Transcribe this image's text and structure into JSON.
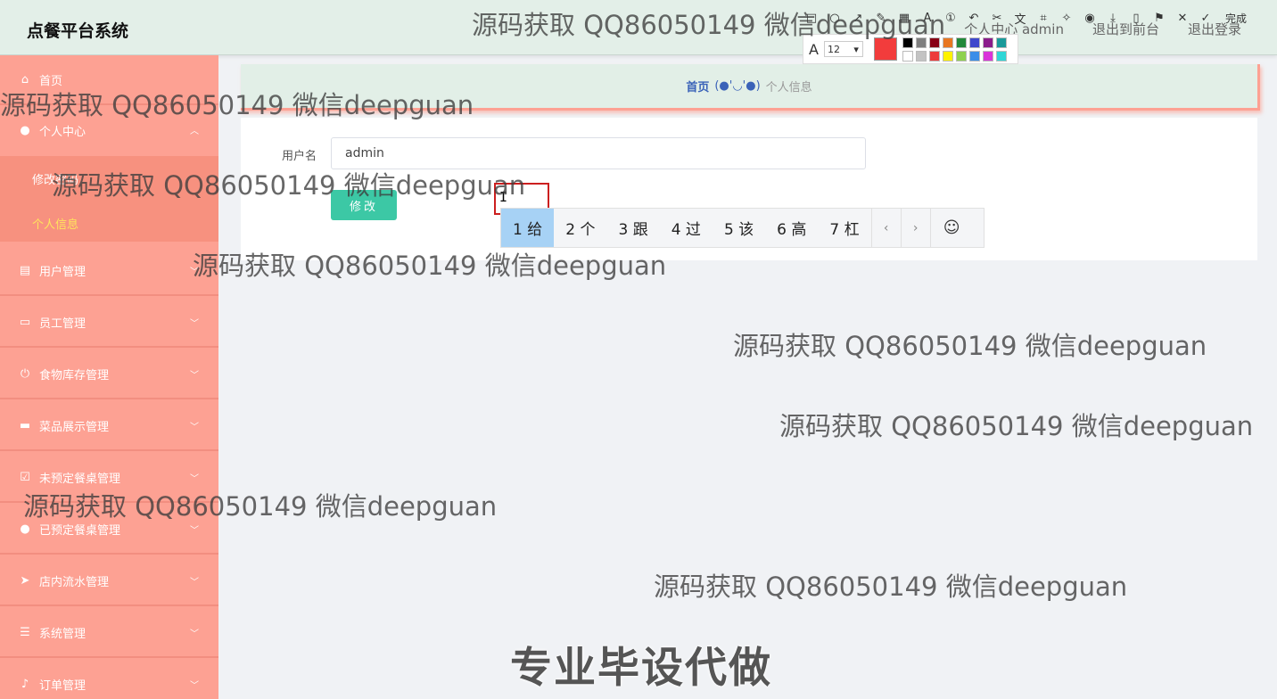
{
  "app": {
    "title": "点餐平台系统"
  },
  "header": {
    "links": [
      "个人中心 admin",
      "退出到前台",
      "退出登录"
    ]
  },
  "sidebar": {
    "items": [
      {
        "label": "首页",
        "icon": "home-icon"
      },
      {
        "label": "个人中心",
        "icon": "user-icon",
        "expanded": true
      },
      {
        "label": "用户管理",
        "icon": "clipboard-icon"
      },
      {
        "label": "员工管理",
        "icon": "id-card-icon"
      },
      {
        "label": "食物库存管理",
        "icon": "power-icon"
      },
      {
        "label": "菜品展示管理",
        "icon": "monitor-icon"
      },
      {
        "label": "未预定餐桌管理",
        "icon": "checklist-icon"
      },
      {
        "label": "已预定餐桌管理",
        "icon": "bulb-icon"
      },
      {
        "label": "店内流水管理",
        "icon": "send-icon"
      },
      {
        "label": "系统管理",
        "icon": "sliders-icon"
      },
      {
        "label": "订单管理",
        "icon": "bell-off-icon"
      }
    ],
    "submenu": [
      {
        "label": "修改密码"
      },
      {
        "label": "个人信息",
        "active": true
      }
    ]
  },
  "breadcrumb": {
    "home": "首页",
    "separator": "(●'◡'●)",
    "current": "个人信息"
  },
  "form": {
    "username_label": "用户名",
    "username_value": "admin",
    "submit_label": "修改"
  },
  "ime": {
    "candidates": [
      "1 给",
      "2 个",
      "3 跟",
      "4 过",
      "5 该",
      "6 高",
      "7 杠"
    ],
    "prev": "‹",
    "next": "›",
    "emoji": "☺"
  },
  "screenshot_tool": {
    "done_label": "完成",
    "font_size": "12",
    "current_color": "#f23c3c",
    "palette": [
      "#000000",
      "#7f7f7f",
      "#880015",
      "#e87722",
      "#22893a",
      "#3f48cc",
      "#8b1c8b",
      "#1a9a9a",
      "#ffffff",
      "#c3c3c3",
      "#ed3b3b",
      "#fff200",
      "#8fd14f",
      "#3a8de8",
      "#d933d9",
      "#2ed6d6"
    ]
  },
  "watermark": {
    "text": "源码获取 QQ86050149 微信deepguan",
    "footer": "专业毕设代做"
  }
}
